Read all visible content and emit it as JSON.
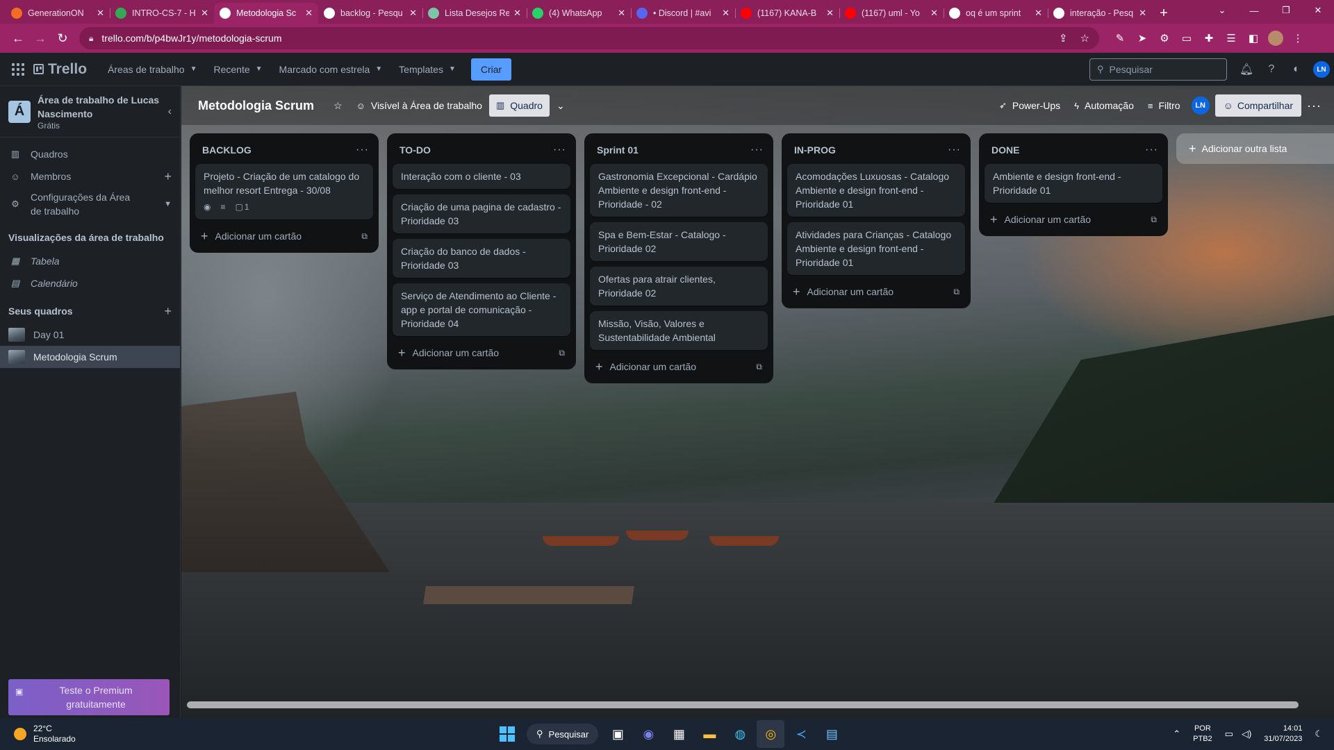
{
  "browser": {
    "tabs": [
      {
        "title": "GenerationON",
        "fav_color": "#f36c21"
      },
      {
        "title": "INTRO-CS-7 - H",
        "fav_color": "#34a853"
      },
      {
        "title": "Metodologia Sc",
        "fav_color": "#ffffff"
      },
      {
        "title": "backlog - Pesqu",
        "fav_color": "#ffffff"
      },
      {
        "title": "Lista Desejos Re",
        "fav_color": "#7cc5a8"
      },
      {
        "title": "(4) WhatsApp",
        "fav_color": "#25d366"
      },
      {
        "title": "• Discord | #avi",
        "fav_color": "#5865f2"
      },
      {
        "title": "(1167) KANA-B",
        "fav_color": "#ff0000"
      },
      {
        "title": "(1167) uml - Yo",
        "fav_color": "#ff0000"
      },
      {
        "title": "oq é um sprint",
        "fav_color": "#ffffff"
      },
      {
        "title": "interação - Pesq",
        "fav_color": "#ffffff"
      }
    ],
    "active_tab_index": 2,
    "url": "trello.com/b/p4bwJr1y/metodologia-scrum",
    "accent": "#9b2467"
  },
  "header": {
    "logo": "Trello",
    "menus": [
      "Áreas de trabalho",
      "Recente",
      "Marcado com estrela",
      "Templates"
    ],
    "create_label": "Criar",
    "search_placeholder": "Pesquisar",
    "user_initials": "LN"
  },
  "sidebar": {
    "workspace_initial": "Á",
    "workspace_name": "Área de trabalho de Lucas Nascimento",
    "workspace_plan": "Grátis",
    "items": [
      {
        "label": "Quadros",
        "icon": "board-icon"
      },
      {
        "label": "Membros",
        "icon": "members-icon"
      },
      {
        "label": "Configurações da Área de trabalho",
        "icon": "gear-icon"
      }
    ],
    "views_title": "Visualizações da área de trabalho",
    "views": [
      {
        "label": "Tabela",
        "icon": "table-icon"
      },
      {
        "label": "Calendário",
        "icon": "calendar-icon"
      }
    ],
    "boards_title": "Seus quadros",
    "boards": [
      {
        "label": "Day 01",
        "selected": false
      },
      {
        "label": "Metodologia Scrum",
        "selected": true
      }
    ],
    "premium_label": "Teste o Premium gratuitamente"
  },
  "board": {
    "name": "Metodologia Scrum",
    "visibility_label": "Visível à Área de trabalho",
    "view_label": "Quadro",
    "powerups_label": "Power-Ups",
    "automation_label": "Automação",
    "filter_label": "Filtro",
    "member_initials": "LN",
    "share_label": "Compartilhar",
    "add_card_label": "Adicionar um cartão",
    "add_list_label": "Adicionar outra lista",
    "lists": [
      {
        "title": "BACKLOG",
        "cards": [
          {
            "text": "Projeto - Criação de um catalogo do melhor resort Entrega - 30/08",
            "comments": "1"
          }
        ]
      },
      {
        "title": "TO-DO",
        "cards": [
          {
            "text": "Interação com o cliente - 03"
          },
          {
            "text": "Criação de uma pagina de cadastro - Prioridade 03"
          },
          {
            "text": "Criação do banco de dados - Prioridade 03"
          },
          {
            "text": "Serviço de Atendimento ao Cliente - app e portal de comunicação - Prioridade 04"
          }
        ]
      },
      {
        "title": "Sprint 01",
        "cards": [
          {
            "text": "Gastronomia Excepcional - Cardápio Ambiente e design front-end - Prioridade - 02"
          },
          {
            "text": "Spa e Bem-Estar - Catalogo - Prioridade 02"
          },
          {
            "text": "Ofertas para atrair clientes, Prioridade 02"
          },
          {
            "text": "Missão, Visão, Valores e Sustentabilidade Ambiental"
          }
        ]
      },
      {
        "title": "IN-PROG",
        "cards": [
          {
            "text": "Acomodações Luxuosas - Catalogo Ambiente e design front-end - Prioridade 01"
          },
          {
            "text": "Atividades para Crianças - Catalogo Ambiente e design front-end - Prioridade 01"
          }
        ]
      },
      {
        "title": "DONE",
        "cards": [
          {
            "text": "Ambiente e design front-end - Prioridade 01"
          }
        ]
      }
    ]
  },
  "taskbar": {
    "weather_temp": "22°C",
    "weather_desc": "Ensolarado",
    "search_label": "Pesquisar",
    "lang_line1": "POR",
    "lang_line2": "PTB2",
    "time": "14:01",
    "date": "31/07/2023"
  }
}
